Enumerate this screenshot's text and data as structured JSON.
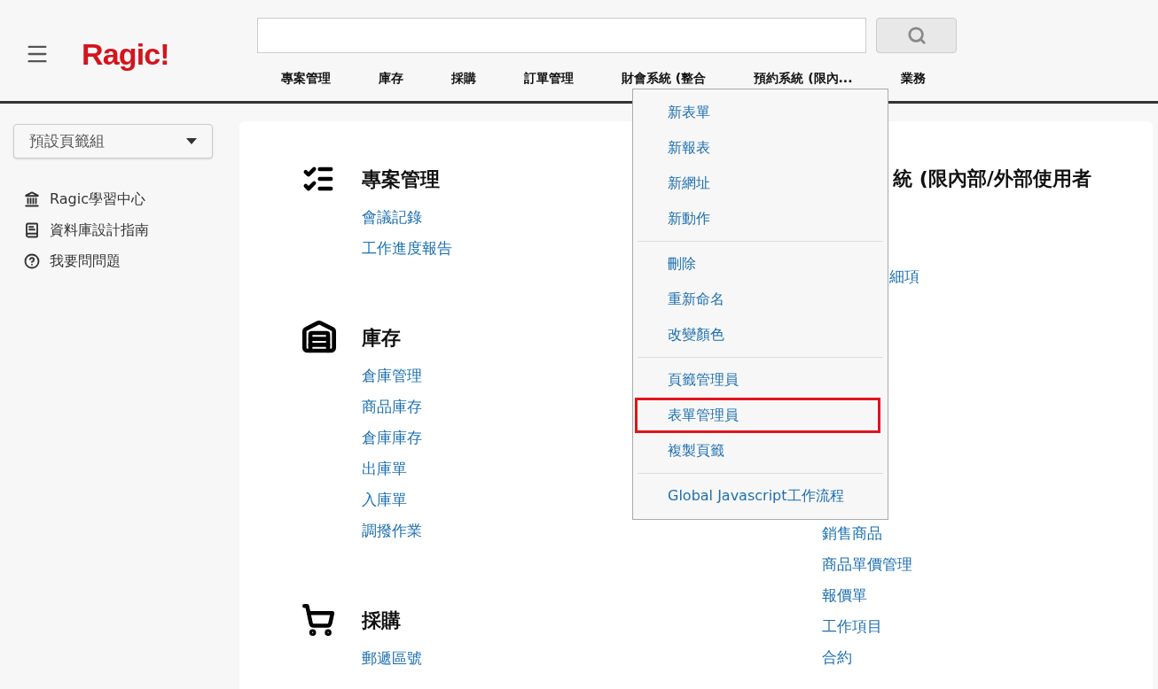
{
  "header": {
    "logo": "Ragic!",
    "tabs": [
      {
        "label": "專案管理",
        "selected": false
      },
      {
        "label": "庫存",
        "selected": false
      },
      {
        "label": "採購",
        "selected": false
      },
      {
        "label": "訂單管理",
        "selected": false
      },
      {
        "label": "財會系統 (整合",
        "selected": false
      },
      {
        "label": "預約系統 (限內...",
        "selected": false
      },
      {
        "label": "業務",
        "selected": false
      }
    ]
  },
  "sidebar": {
    "dropdown": "預設頁籤組",
    "links": [
      {
        "kind": "school",
        "label": "Ragic學習中心"
      },
      {
        "kind": "book",
        "label": "資料庫設計指南"
      },
      {
        "kind": "question",
        "label": "我要問問題"
      }
    ]
  },
  "sections": [
    {
      "kind": "checklist",
      "title": "專案管理",
      "items": [
        "會議記錄",
        "工作進度報告"
      ]
    },
    {
      "kind": "warehouse",
      "title": "庫存",
      "items": [
        "倉庫管理",
        "商品庫存",
        "倉庫庫存",
        "出庫單",
        "入庫單",
        "調撥作業"
      ]
    },
    {
      "kind": "cart",
      "title": "採購",
      "items": [
        "郵遞區號"
      ]
    }
  ],
  "right_column": {
    "title": "統 (限內部/外部使用者",
    "partial_item": "細項",
    "items": [
      "銷售商品",
      "商品單價管理",
      "報價單",
      "工作項目",
      "合約"
    ]
  },
  "menu": {
    "groups": [
      [
        {
          "label": "新表單",
          "highlighted": false
        },
        {
          "label": "新報表",
          "highlighted": false
        },
        {
          "label": "新網址",
          "highlighted": false
        },
        {
          "label": "新動作",
          "highlighted": false
        }
      ],
      [
        {
          "label": "刪除",
          "highlighted": false
        },
        {
          "label": "重新命名",
          "highlighted": false
        },
        {
          "label": "改變顏色",
          "highlighted": false
        }
      ],
      [
        {
          "label": "頁籤管理員",
          "highlighted": false
        },
        {
          "label": "表單管理員",
          "highlighted": true
        },
        {
          "label": "複製頁籤",
          "highlighted": false
        }
      ],
      [
        {
          "label": "Global Javascript工作流程",
          "highlighted": false
        }
      ]
    ]
  }
}
